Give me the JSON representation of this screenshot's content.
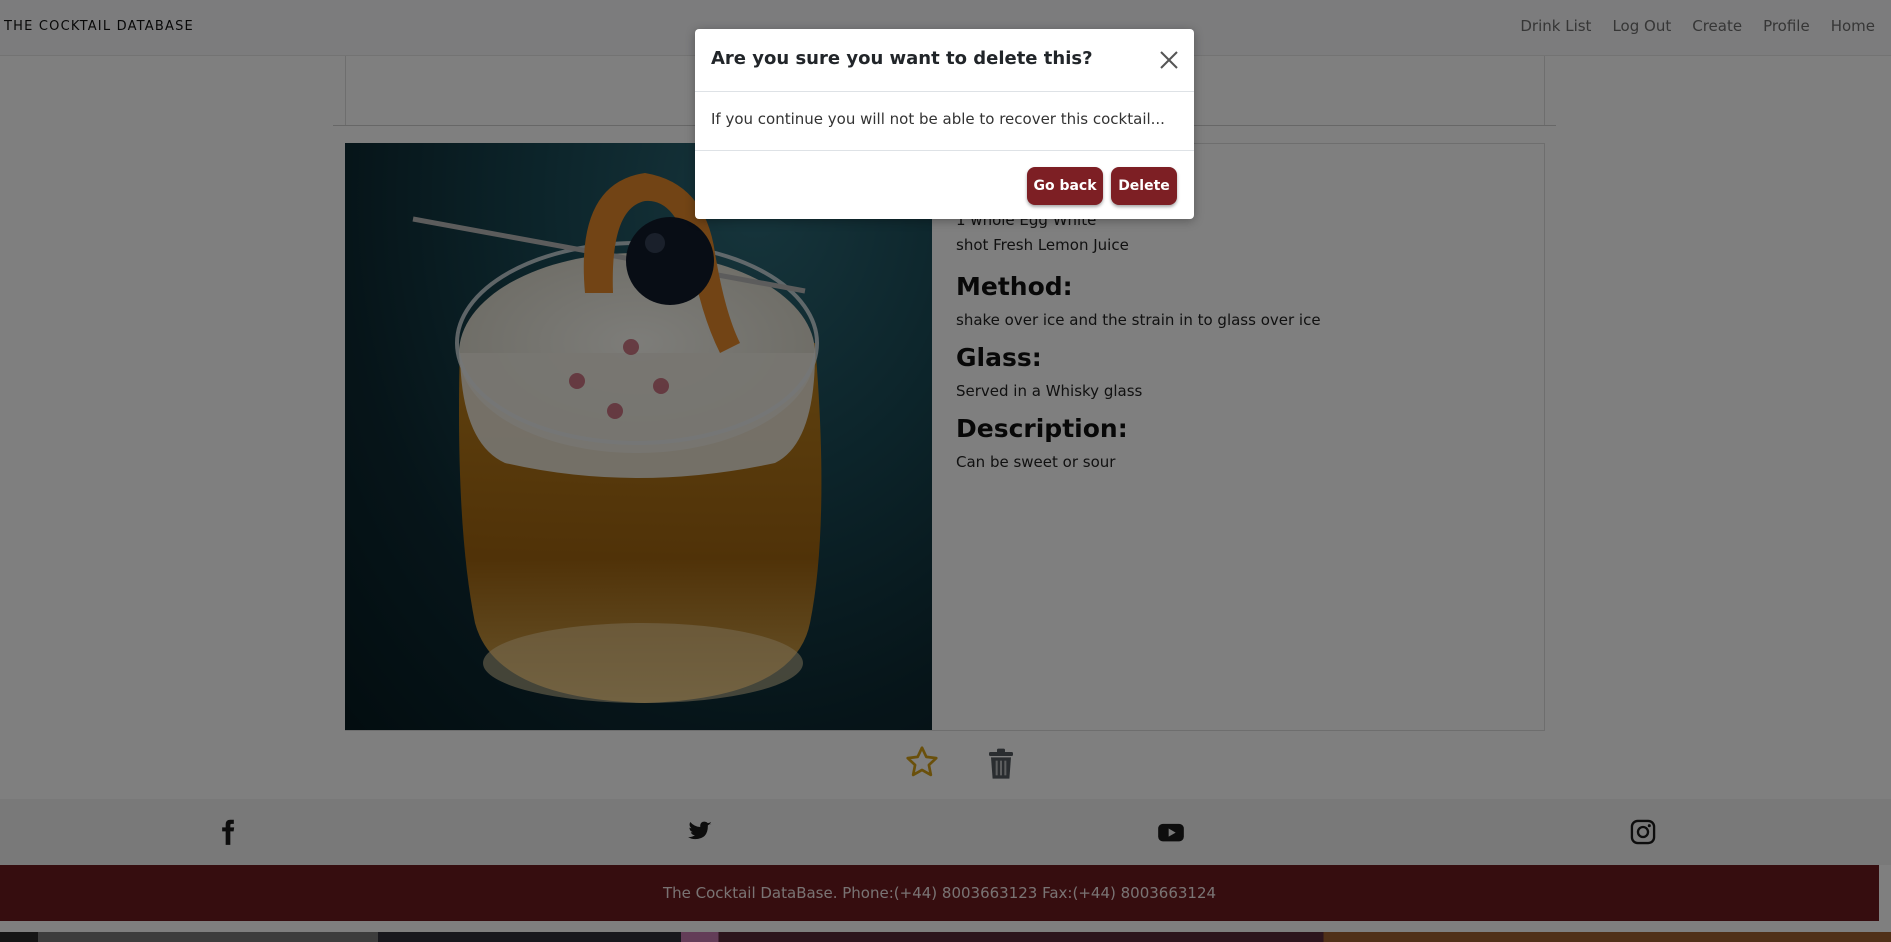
{
  "navbar": {
    "brand": "THE COCKTAIL DATABASE",
    "links": [
      "Drink List",
      "Log Out",
      "Create",
      "Profile",
      "Home"
    ]
  },
  "cocktail": {
    "ingredients": [
      "1 whole Egg White",
      "shot Fresh Lemon Juice"
    ],
    "method_heading": "Method:",
    "method_text": "shake over ice and the strain in to glass over ice",
    "glass_heading": "Glass:",
    "glass_text": "Served in a Whisky glass",
    "description_heading": "Description:",
    "description_text": "Can be sweet or sour"
  },
  "actions": {
    "favorite_icon": "star-icon",
    "delete_icon": "trash-icon"
  },
  "social": [
    "facebook-icon",
    "twitter-icon",
    "youtube-icon",
    "instagram-icon"
  ],
  "footer": {
    "text": "The Cocktail DataBase. Phone:(+44) 8003663123 Fax:(+44) 8003663124"
  },
  "modal": {
    "title": "Are you sure you want to delete this?",
    "body": "If you continue you will not be able to recover this cocktail...",
    "back_label": "Go back",
    "delete_label": "Delete"
  },
  "colors": {
    "brand_dark_red": "#7d1f24",
    "footer_bg": "#6d1a1e",
    "star_gold": "#d4a017"
  }
}
